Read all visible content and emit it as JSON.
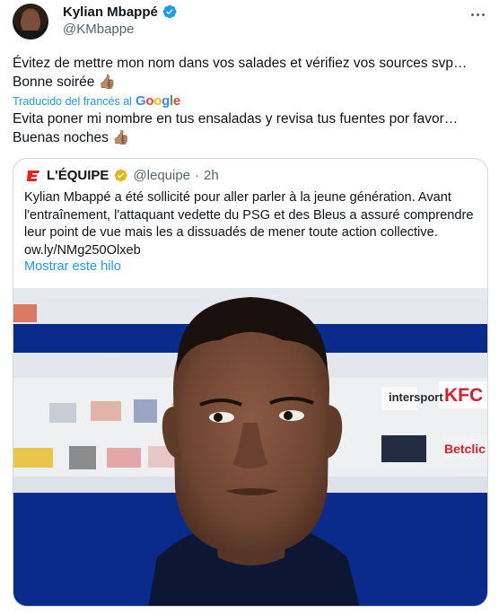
{
  "author": {
    "display_name": "Kylian Mbappé",
    "handle": "@KMbappe"
  },
  "tweet": {
    "text": "Évitez de mettre mon nom dans vos salades et vérifiez vos sources svp…\nBonne soirée 👍🏽",
    "translated_label": "Traducido del francés al",
    "translator": "Google",
    "translation": "Evita poner mi nombre en tus ensaladas y revisa tus fuentes por favor…\nBuenas noches 👍🏽"
  },
  "quoted": {
    "name": "L'ÉQUIPE",
    "handle": "@lequipe",
    "separator": "·",
    "time": "2h",
    "text": "Kylian Mbappé a été sollicité pour aller parler à la jeune génération. Avant\nl'entraînement, l'attaquant vedette du PSG et des Bleus a assuré comprendre\nleur point de vue mais les a dissuadés de mener toute action collective.\now.ly/NMg250Olxeb",
    "show_thread": "Mostrar este hilo",
    "media_sponsors": [
      "intersport",
      "KFC",
      "Betclic"
    ]
  },
  "icons": {
    "verified": "verified-badge-icon",
    "gold_verified": "gold-verified-badge-icon",
    "more": "more-options-icon"
  },
  "colors": {
    "accent": "#1d9bf0",
    "secondary_text": "#536471",
    "border": "#cfd9de",
    "lequipe_red": "#e32219",
    "gold": "#e2b719"
  }
}
